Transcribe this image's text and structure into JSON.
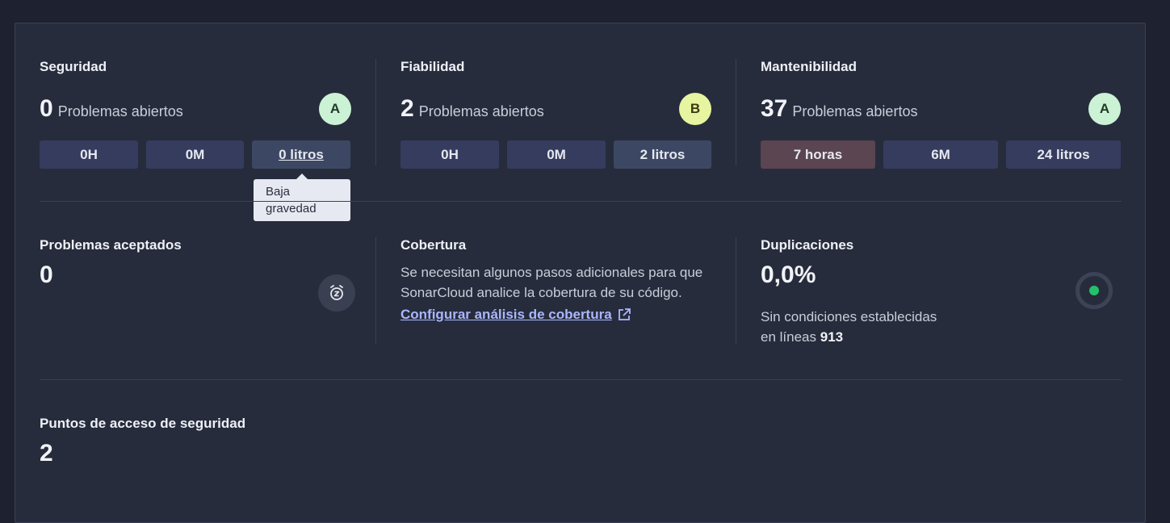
{
  "security": {
    "title": "Seguridad",
    "count": "0",
    "count_label": "Problemas abiertos",
    "grade": "A",
    "chips": [
      "0H",
      "0M",
      "0 litros"
    ]
  },
  "tooltip": {
    "line1": "Baja",
    "line2": "gravedad"
  },
  "reliability": {
    "title": "Fiabilidad",
    "count": "2",
    "count_label": "Problemas abiertos",
    "grade": "B",
    "chips": [
      "0H",
      "0M",
      "2 litros"
    ]
  },
  "maintainability": {
    "title": "Mantenibilidad",
    "count": "37",
    "count_label": "Problemas abiertos",
    "grade": "A",
    "chips": [
      "7 horas",
      "6M",
      "24 litros"
    ]
  },
  "accepted": {
    "title": "Problemas aceptados",
    "count": "0",
    "icon": "snooze-clock-icon"
  },
  "coverage": {
    "title": "Cobertura",
    "description": "Se necesitan algunos pasos adicionales para que SonarCloud analice la cobertura de su código.",
    "link": "Configurar análisis de cobertura",
    "link_icon": "external-link-icon"
  },
  "duplications": {
    "title": "Duplicaciones",
    "value": "0,0%",
    "desc_line1": "Sin condiciones establecidas",
    "desc_prefix": "en líneas",
    "desc_lines": "913"
  },
  "hotspots": {
    "title": "Puntos de acceso de seguridad",
    "count": "2"
  },
  "colors": {
    "panel_bg": "#272c3c",
    "chip_bg": "#363c5e",
    "grade_a": "#ccf2d6",
    "grade_b": "#e7f4a0",
    "link": "#aab7ff",
    "dup_ok": "#23c16b"
  }
}
